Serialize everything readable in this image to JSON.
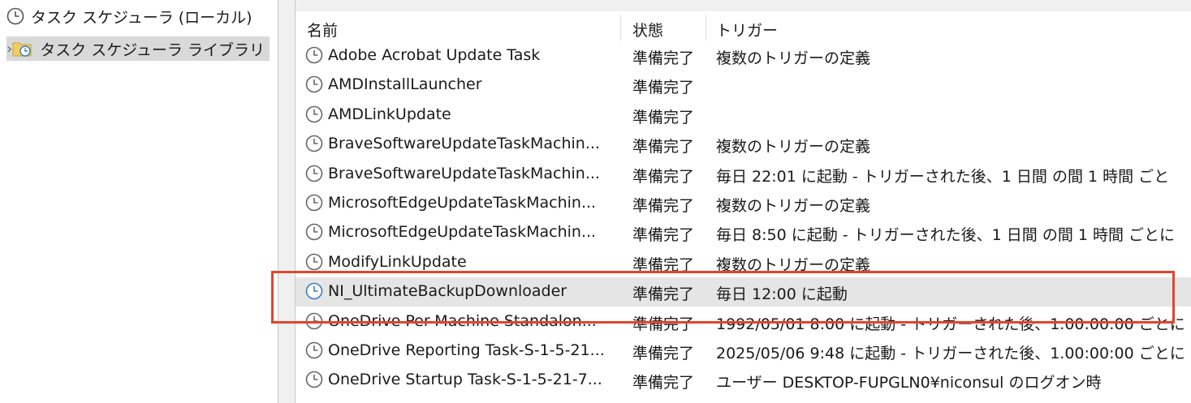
{
  "tree": {
    "root_label": "タスク スケジューラ (ローカル)",
    "library_label": "タスク スケジューラ ライブラリ",
    "expand_glyph": "›"
  },
  "columns": {
    "name": "名前",
    "status": "状態",
    "trigger": "トリガー"
  },
  "tasks": [
    {
      "name": "Adobe Acrobat Update Task",
      "status": "準備完了",
      "trigger": "複数のトリガーの定義"
    },
    {
      "name": "AMDInstallLauncher",
      "status": "準備完了",
      "trigger": ""
    },
    {
      "name": "AMDLinkUpdate",
      "status": "準備完了",
      "trigger": ""
    },
    {
      "name": "BraveSoftwareUpdateTaskMachin...",
      "status": "準備完了",
      "trigger": "複数のトリガーの定義"
    },
    {
      "name": "BraveSoftwareUpdateTaskMachin...",
      "status": "準備完了",
      "trigger": "毎日 22:01 に起動 - トリガーされた後、1 日間 の間 1 時間 ごと"
    },
    {
      "name": "MicrosoftEdgeUpdateTaskMachin...",
      "status": "準備完了",
      "trigger": "複数のトリガーの定義"
    },
    {
      "name": "MicrosoftEdgeUpdateTaskMachin...",
      "status": "準備完了",
      "trigger": "毎日 8:50 に起動 - トリガーされた後、1 日間 の間 1 時間 ごとに"
    },
    {
      "name": "ModifyLinkUpdate",
      "status": "準備完了",
      "trigger": "複数のトリガーの定義"
    },
    {
      "name": "NI_UltimateBackupDownloader",
      "status": "準備完了",
      "trigger": "毎日 12:00 に起動",
      "selected": true
    },
    {
      "name": "OneDrive Per-Machine Standalon...",
      "status": "準備完了",
      "trigger": "1992/05/01 8:00 に起動 - トリガーされた後、1.00:00:00 ごとに"
    },
    {
      "name": "OneDrive Reporting Task-S-1-5-21...",
      "status": "準備完了",
      "trigger": "2025/05/06 9:48 に起動 - トリガーされた後、1.00:00:00 ごとに"
    },
    {
      "name": "OneDrive Startup Task-S-1-5-21-7...",
      "status": "準備完了",
      "trigger": "ユーザー DESKTOP-FUPGLN0¥niconsul のログオン時"
    }
  ],
  "colors": {
    "highlight_box": "#e0462e",
    "selected_row": "#e5e5e5",
    "tree_selected": "#d9d9d9"
  },
  "icons": {
    "task": "clock-icon",
    "library": "folder-clock-icon"
  }
}
